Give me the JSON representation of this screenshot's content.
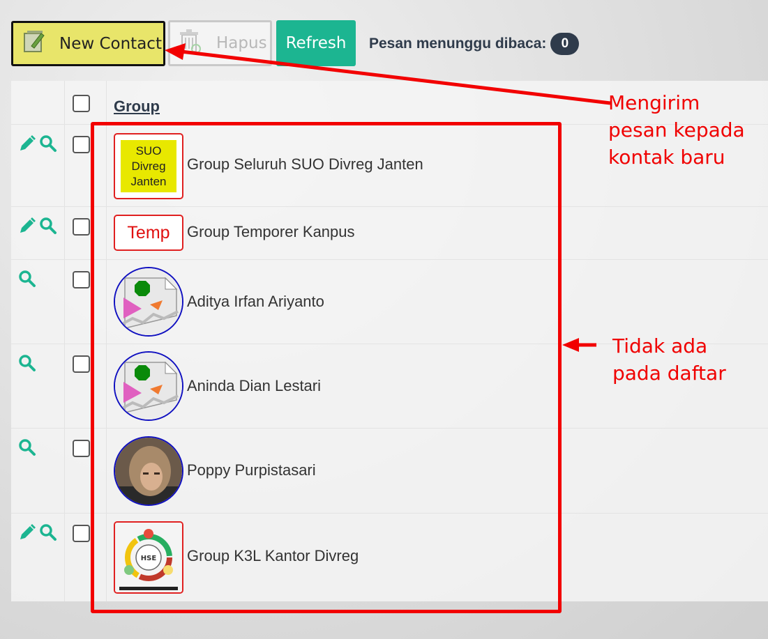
{
  "toolbar": {
    "new_contact_label": "New Contact",
    "hapus_label": "Hapus",
    "refresh_label": "Refresh",
    "pending_label": "Pesan menunggu dibaca:",
    "pending_count": "0"
  },
  "table": {
    "header_group": "Group",
    "rows": [
      {
        "name": "Group Seluruh SUO Divreg Janten",
        "thumb_text": "SUO Divreg Janten",
        "editable": true
      },
      {
        "name": "Group Temporer Kanpus",
        "thumb_text": "Temp",
        "editable": true
      },
      {
        "name": "Aditya Irfan Ariyanto",
        "editable": false
      },
      {
        "name": "Aninda Dian Lestari",
        "editable": false
      },
      {
        "name": "Poppy Purpistasari",
        "editable": false
      },
      {
        "name": "Group K3L Kantor Divreg",
        "thumb_text": "HSE",
        "editable": true
      }
    ]
  },
  "annotations": {
    "new_contact_note": "Mengirim pesan kepada kontak baru",
    "list_note": "Tidak ada pada daftar"
  },
  "colors": {
    "accent": "#1cb591",
    "annotation": "#f00000",
    "new_contact_bg": "#e8e56a",
    "badge_bg": "#2f3b4b"
  }
}
